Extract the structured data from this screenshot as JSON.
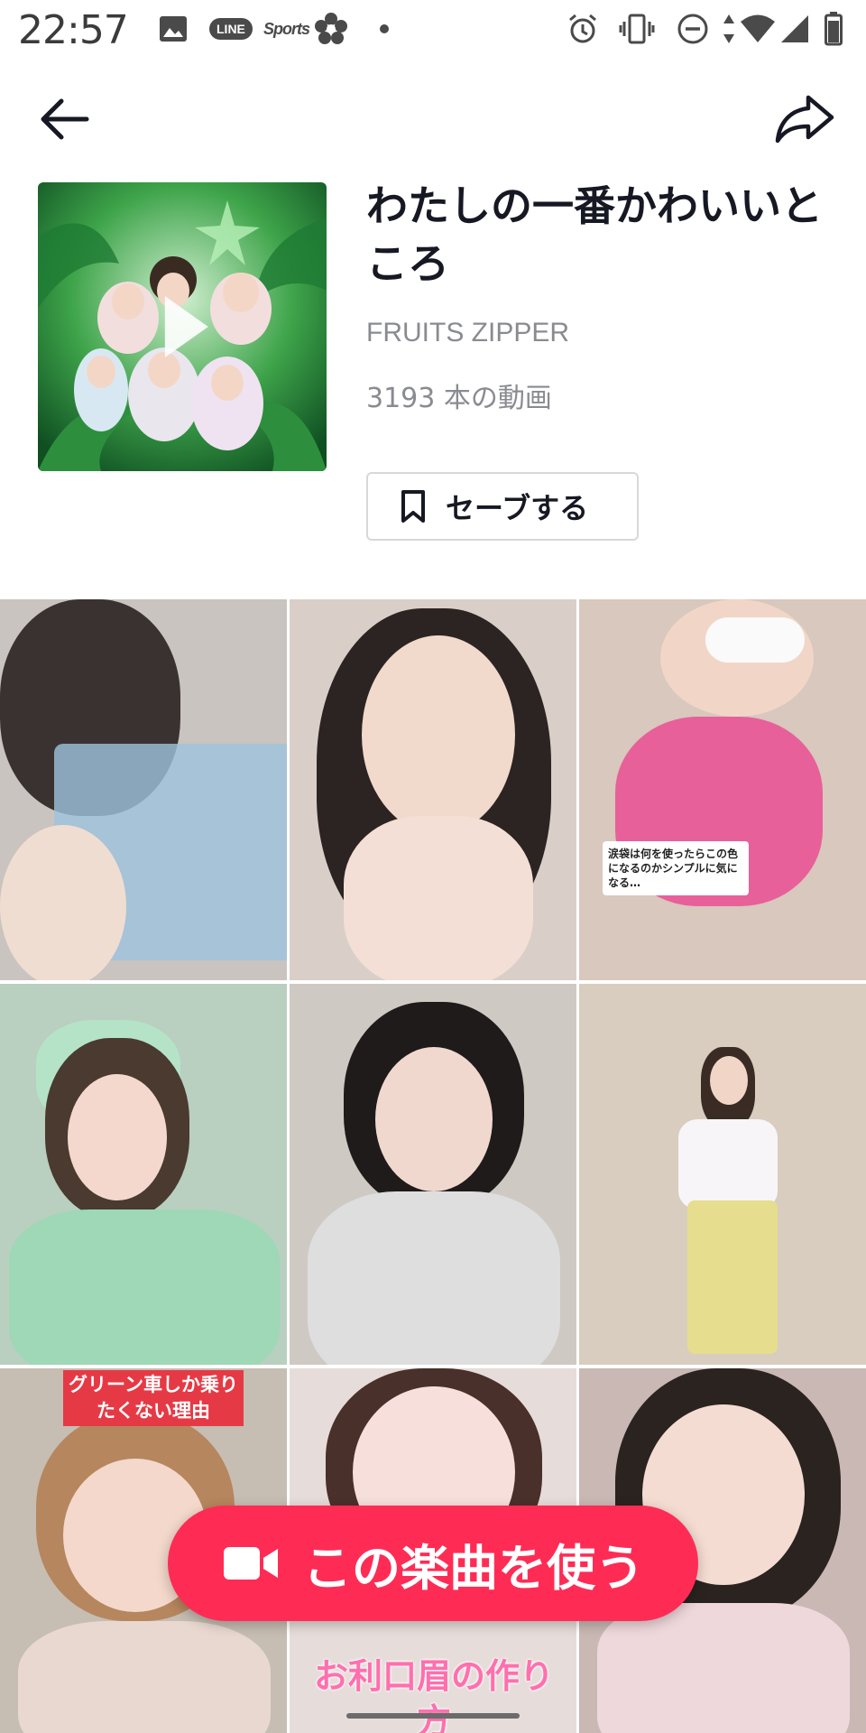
{
  "status_bar": {
    "time": "22:57",
    "notification_icons": [
      "gallery-icon",
      "line-icon",
      "sports-app-icon",
      "flower-app-icon",
      "more-dot-icon"
    ],
    "line_badge": "LINE",
    "sports_text": "Sports",
    "system_icons": [
      "alarm-icon",
      "vibrate-icon",
      "do-not-disturb-icon",
      "data-arrows-icon",
      "wifi-icon",
      "signal-icon",
      "battery-icon"
    ]
  },
  "header": {
    "back_icon": "arrow-left-icon",
    "share_icon": "share-arrow-icon"
  },
  "music": {
    "title": "わたしの一番かわいいところ",
    "artist": "FRUITS ZIPPER",
    "video_count": "3193 本の動画",
    "save_label": "セーブする"
  },
  "videos": [
    {
      "bg": "#c9c4bf",
      "caption": ""
    },
    {
      "bg": "#d9cfc8",
      "caption": ""
    },
    {
      "bg": "#d8c8bd",
      "caption": "涙袋は何を使ったらこの色になるのかシンプルに気になる…"
    },
    {
      "bg": "#b9cfc0",
      "caption": ""
    },
    {
      "bg": "#cfc9c4",
      "caption": ""
    },
    {
      "bg": "#d8cdbf",
      "caption": ""
    },
    {
      "bg": "#c6bdb3",
      "caption": "グリーン車しか乗りたくない理由"
    },
    {
      "bg": "#e6dcd9",
      "caption": "お利口眉の作り方"
    },
    {
      "bg": "#c9b8b4",
      "caption": ""
    }
  ],
  "fab": {
    "label": "この楽曲を使う",
    "icon": "video-camera-icon",
    "color": "#fe2c55"
  }
}
